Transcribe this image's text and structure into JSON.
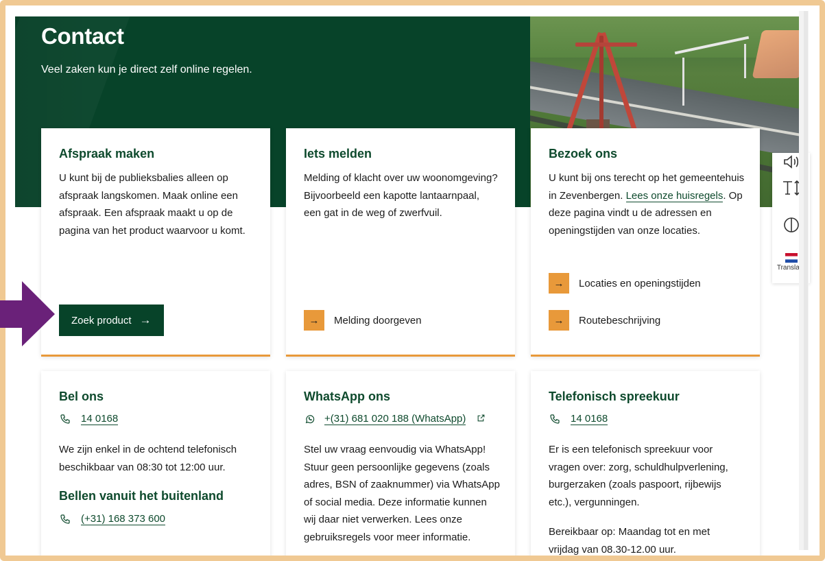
{
  "page": {
    "title": "Contact",
    "intro": "Veel zaken kun je direct zelf online regelen."
  },
  "cards": {
    "appointment": {
      "title": "Afspraak maken",
      "body": "U kunt bij de publieksbalies alleen op afspraak langskomen. Maak online een afspraak. Een afspraak maakt u op de pagina van het product waarvoor u komt.",
      "button_label": "Zoek product",
      "button_icon": "arrow-right-icon"
    },
    "report": {
      "title": "Iets melden",
      "body": "Melding of klacht over uw woonomgeving? Bijvoorbeeld een kapotte lantaarnpaal, een gat in de weg of zwerfvuil.",
      "link_label": "Melding doorgeven"
    },
    "visit": {
      "title": "Bezoek ons",
      "body_before": "U kunt bij ons terecht op het gemeentehuis in Zevenbergen. ",
      "body_link": "Lees onze huisregels",
      "body_after": ". Op deze pagina vindt u de adressen en openingstijden van onze locaties.",
      "link1_label": "Locaties en openingstijden",
      "link2_label": "Routebeschrijving"
    },
    "call": {
      "title": "Bel ons",
      "phone": "14 0168",
      "note": "We zijn enkel in de ochtend telefonisch beschikbaar van 08:30 tot 12:00 uur.",
      "abroad_title": "Bellen vanuit het buitenland",
      "abroad_phone": "(+31) 168 373 600"
    },
    "whatsapp": {
      "title": "WhatsApp ons",
      "number": "+(31) 681 020 188 (WhatsApp)",
      "body": "Stel uw vraag eenvoudig via WhatsApp! Stuur geen persoonlijke gegevens (zoals adres, BSN of zaaknummer) via WhatsApp of social media. Deze informatie kunnen wij daar niet verwerken. Lees onze gebruiksregels voor meer informatie."
    },
    "consult": {
      "title": "Telefonisch spreekuur",
      "phone": "14 0168",
      "body": "Er is een telefonisch spreekuur voor vragen over: zorg, schuldhulpverlening, burgerzaken (zoals paspoort, rijbewijs etc.), vergunningen.",
      "availability": "Bereikbaar op: Maandag tot en met vrijdag van 08.30-12.00 uur."
    }
  },
  "toolbar": {
    "tools": [
      "speaker-icon",
      "text-size-icon",
      "contrast-icon",
      "flag-icon"
    ],
    "translate_label": "Translate"
  },
  "colors": {
    "brand_green": "#074329",
    "accent_orange": "#e8993a",
    "frame": "#f0c993",
    "pointer_purple": "#6a2179"
  }
}
